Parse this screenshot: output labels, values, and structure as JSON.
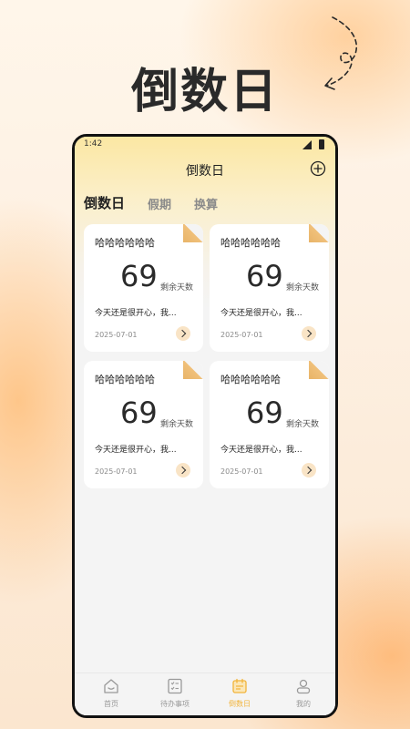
{
  "headline": "倒数日",
  "status_bar": {
    "time": "1:42"
  },
  "header": {
    "title": "倒数日"
  },
  "tabs": [
    {
      "label": "倒数日",
      "active": true
    },
    {
      "label": "假期",
      "active": false
    },
    {
      "label": "换算",
      "active": false
    }
  ],
  "cards": [
    {
      "title": "哈哈哈哈哈哈",
      "days": "69",
      "unit": "剩余天数",
      "desc": "今天还是很开心，我...",
      "date": "2025-07-01"
    },
    {
      "title": "哈哈哈哈哈哈",
      "days": "69",
      "unit": "剩余天数",
      "desc": "今天还是很开心，我...",
      "date": "2025-07-01"
    },
    {
      "title": "哈哈哈哈哈哈",
      "days": "69",
      "unit": "剩余天数",
      "desc": "今天还是很开心，我...",
      "date": "2025-07-01"
    },
    {
      "title": "哈哈哈哈哈哈",
      "days": "69",
      "unit": "剩余天数",
      "desc": "今天还是很开心，我...",
      "date": "2025-07-01"
    }
  ],
  "bottom_nav": [
    {
      "label": "首页",
      "icon": "home-icon",
      "active": false
    },
    {
      "label": "待办事项",
      "icon": "todo-list-icon",
      "active": false
    },
    {
      "label": "倒数日",
      "icon": "calendar-icon",
      "active": true
    },
    {
      "label": "我的",
      "icon": "user-icon",
      "active": false
    }
  ],
  "colors": {
    "accent": "#f2b43a",
    "card_fold": "#e8b468",
    "arrow_bg": "#f9e4c6"
  }
}
